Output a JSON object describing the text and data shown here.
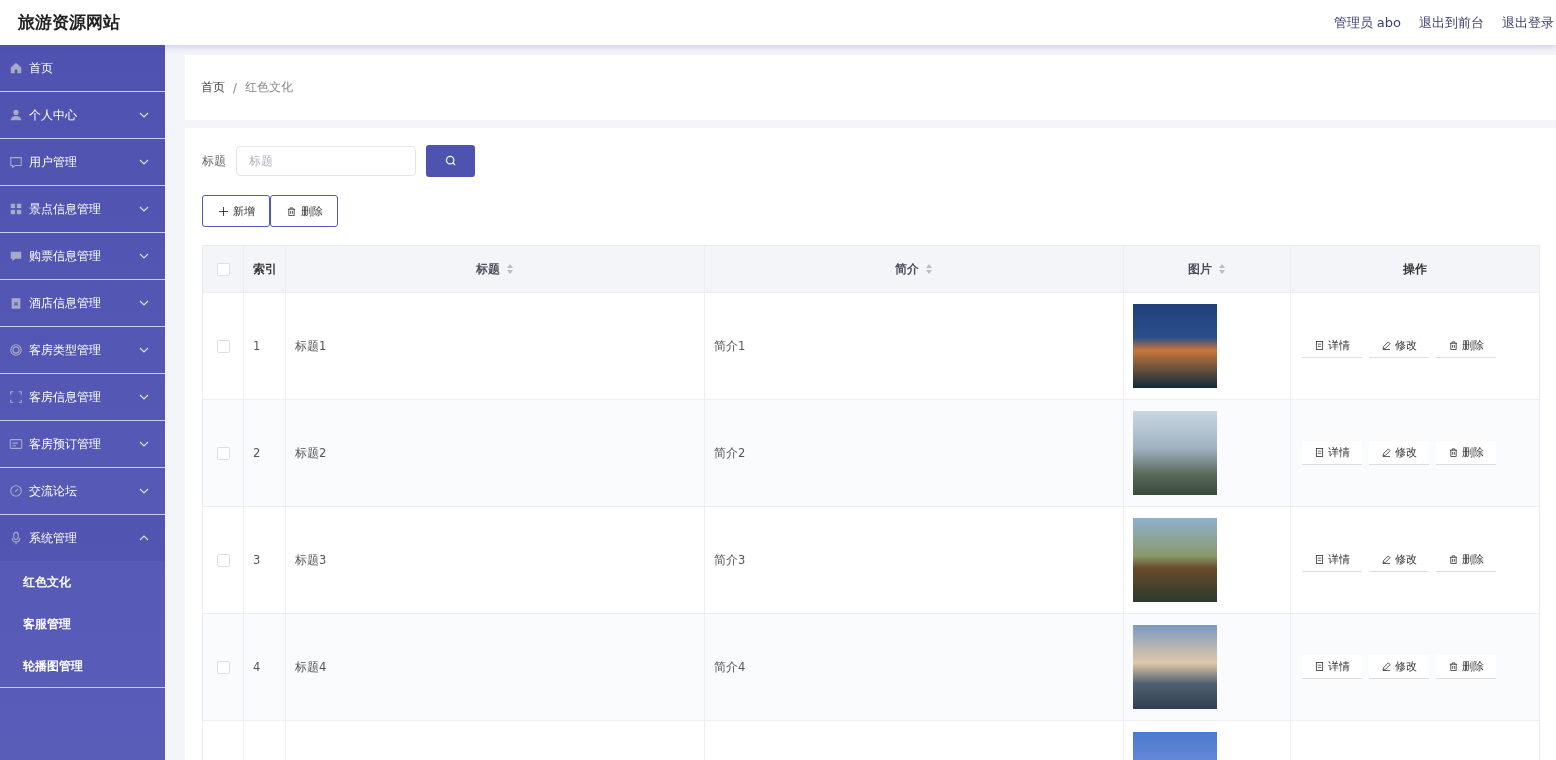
{
  "header": {
    "site_title": "旅游资源网站",
    "links": [
      "管理员 abo",
      "退出到前台",
      "退出登录"
    ]
  },
  "sidebar": {
    "items": [
      {
        "label": "首页",
        "has_children": false,
        "expanded": false
      },
      {
        "label": "个人中心",
        "has_children": true,
        "expanded": false
      },
      {
        "label": "用户管理",
        "has_children": true,
        "expanded": false
      },
      {
        "label": "景点信息管理",
        "has_children": true,
        "expanded": false
      },
      {
        "label": "购票信息管理",
        "has_children": true,
        "expanded": false
      },
      {
        "label": "酒店信息管理",
        "has_children": true,
        "expanded": false
      },
      {
        "label": "客房类型管理",
        "has_children": true,
        "expanded": false
      },
      {
        "label": "客房信息管理",
        "has_children": true,
        "expanded": false
      },
      {
        "label": "客房预订管理",
        "has_children": true,
        "expanded": false
      },
      {
        "label": "交流论坛",
        "has_children": true,
        "expanded": false
      },
      {
        "label": "系统管理",
        "has_children": true,
        "expanded": true,
        "children": [
          {
            "label": "红色文化"
          },
          {
            "label": "客服管理"
          },
          {
            "label": "轮播图管理"
          }
        ]
      }
    ]
  },
  "breadcrumb": [
    "首页",
    "/",
    "红色文化"
  ],
  "search": {
    "label": "标题",
    "placeholder": "标题"
  },
  "actions": [
    {
      "kind": "add",
      "label": "新增"
    },
    {
      "kind": "delete",
      "label": "删除"
    }
  ],
  "table": {
    "select_all_checked": false,
    "columns": [
      {
        "label": "索引",
        "sortable": false
      },
      {
        "label": "标题",
        "sortable": true
      },
      {
        "label": "简介",
        "sortable": true
      },
      {
        "label": "图片",
        "sortable": true
      },
      {
        "label": "操作",
        "sortable": false
      }
    ],
    "rows": [
      {
        "kind": "full",
        "checked": false,
        "index": "1",
        "title": "标题1",
        "intro": "简介1",
        "buttons": [
          {
            "kind": "detail",
            "label": "详情"
          },
          {
            "kind": "edit",
            "label": "修改"
          },
          {
            "kind": "delete",
            "label": "删除"
          }
        ]
      },
      {
        "kind": "full",
        "checked": false,
        "index": "2",
        "title": "标题2",
        "intro": "简介2",
        "buttons": [
          {
            "kind": "detail",
            "label": "详情"
          },
          {
            "kind": "edit",
            "label": "修改"
          },
          {
            "kind": "delete",
            "label": "删除"
          }
        ]
      },
      {
        "kind": "full",
        "checked": false,
        "index": "3",
        "title": "标题3",
        "intro": "简介3",
        "buttons": [
          {
            "kind": "detail",
            "label": "详情"
          },
          {
            "kind": "edit",
            "label": "修改"
          },
          {
            "kind": "delete",
            "label": "删除"
          }
        ]
      },
      {
        "kind": "full",
        "checked": false,
        "index": "4",
        "title": "标题4",
        "intro": "简介4",
        "buttons": [
          {
            "kind": "detail",
            "label": "详情"
          },
          {
            "kind": "edit",
            "label": "修改"
          },
          {
            "kind": "delete",
            "label": "删除"
          }
        ]
      },
      {
        "kind": "partial"
      }
    ]
  }
}
